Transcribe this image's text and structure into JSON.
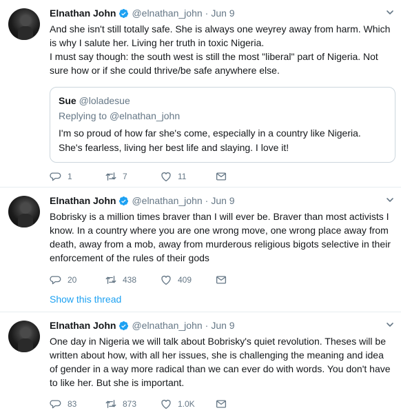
{
  "tweets": [
    {
      "name": "Elnathan John",
      "handle": "@elnathan_john",
      "sep": "·",
      "date": "Jun 9",
      "lines": [
        "And she isn't still totally safe. She is always one weyrey away from harm. Which is why I salute her. Living her truth in toxic Nigeria.",
        "I must say though: the south west is still the most \"liberal\" part of Nigeria. Not sure how or if she could thrive/be safe anywhere else."
      ],
      "quote": {
        "name": "Sue",
        "handle": "@loladesue",
        "reply_prefix": "Replying to ",
        "reply_handle": "@elnathan_john",
        "text": "I'm so proud of how far she's come, especially in a country like Nigeria. She's fearless, living her best life and slaying. I love it!"
      },
      "replies": "1",
      "retweets": "7",
      "likes": "11"
    },
    {
      "name": "Elnathan John",
      "handle": "@elnathan_john",
      "sep": "·",
      "date": "Jun 9",
      "text": "Bobrisky is a million times braver than I will ever be. Braver than most activists I know. In a country where you are one wrong move, one wrong place away from death, away from a mob, away from murderous religious bigots selective in their enforcement of the rules of their gods",
      "replies": "20",
      "retweets": "438",
      "likes": "409",
      "thread_link": "Show this thread"
    },
    {
      "name": "Elnathan John",
      "handle": "@elnathan_john",
      "sep": "·",
      "date": "Jun 9",
      "text": "One day in Nigeria we will talk about Bobrisky's quiet revolution. Theses will be written about how, with all her issues, she is challenging the meaning and idea of gender in a way more radical than we can ever do with words. You don't have to like her. But she is important.",
      "replies": "83",
      "retweets": "873",
      "likes": "1.0K"
    }
  ],
  "colors": {
    "accent": "#1da1f2",
    "muted": "#657786",
    "text": "#14171a",
    "border": "#e6ecf0"
  },
  "icons": [
    "avatar",
    "verified-badge-icon",
    "chevron-down-icon",
    "reply-icon",
    "retweet-icon",
    "like-icon",
    "message-icon"
  ]
}
